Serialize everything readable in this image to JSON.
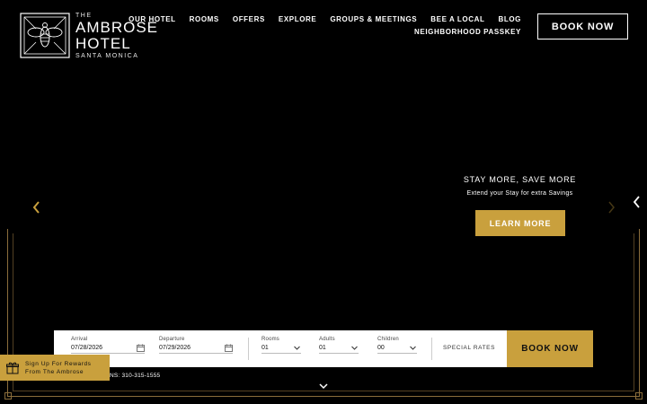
{
  "logo": {
    "the": "THE",
    "line1": "AMBROSE",
    "line2": "HOTEL",
    "sub": "SANTA MONICA"
  },
  "nav": {
    "items": [
      "OUR HOTEL",
      "ROOMS",
      "OFFERS",
      "EXPLORE",
      "GROUPS & MEETINGS",
      "BEE A LOCAL",
      "BLOG"
    ],
    "second_row": "NEIGHBORHOOD PASSKEY"
  },
  "book_now_top": "BOOK NOW",
  "hero": {
    "title": "STAY MORE, SAVE MORE",
    "subtitle": "Extend your Stay for extra Savings",
    "button": "LEARN MORE"
  },
  "booking": {
    "arrival_label": "Arrival",
    "arrival_value": "07/28/2026",
    "departure_label": "Departure",
    "departure_value": "07/29/2026",
    "rooms_label": "Rooms",
    "rooms_value": "01",
    "adults_label": "Adults",
    "adults_value": "01",
    "children_label": "Children",
    "children_value": "00",
    "special_rates": "SPECIAL RATES",
    "book_now": "BOOK NOW"
  },
  "rewards": {
    "line1": "Sign Up For Rewards",
    "line2": "From The Ambrose"
  },
  "phone_text": "NS: 310-315-1555",
  "colors": {
    "accent": "#c9a03d",
    "background": "#000000",
    "frame": "#8a6d3b"
  },
  "icons": [
    "bee-logo-icon",
    "chevron-left-icon",
    "chevron-right-icon",
    "calendar-icon",
    "chevron-down-icon",
    "gift-icon",
    "side-chevron-icon"
  ]
}
